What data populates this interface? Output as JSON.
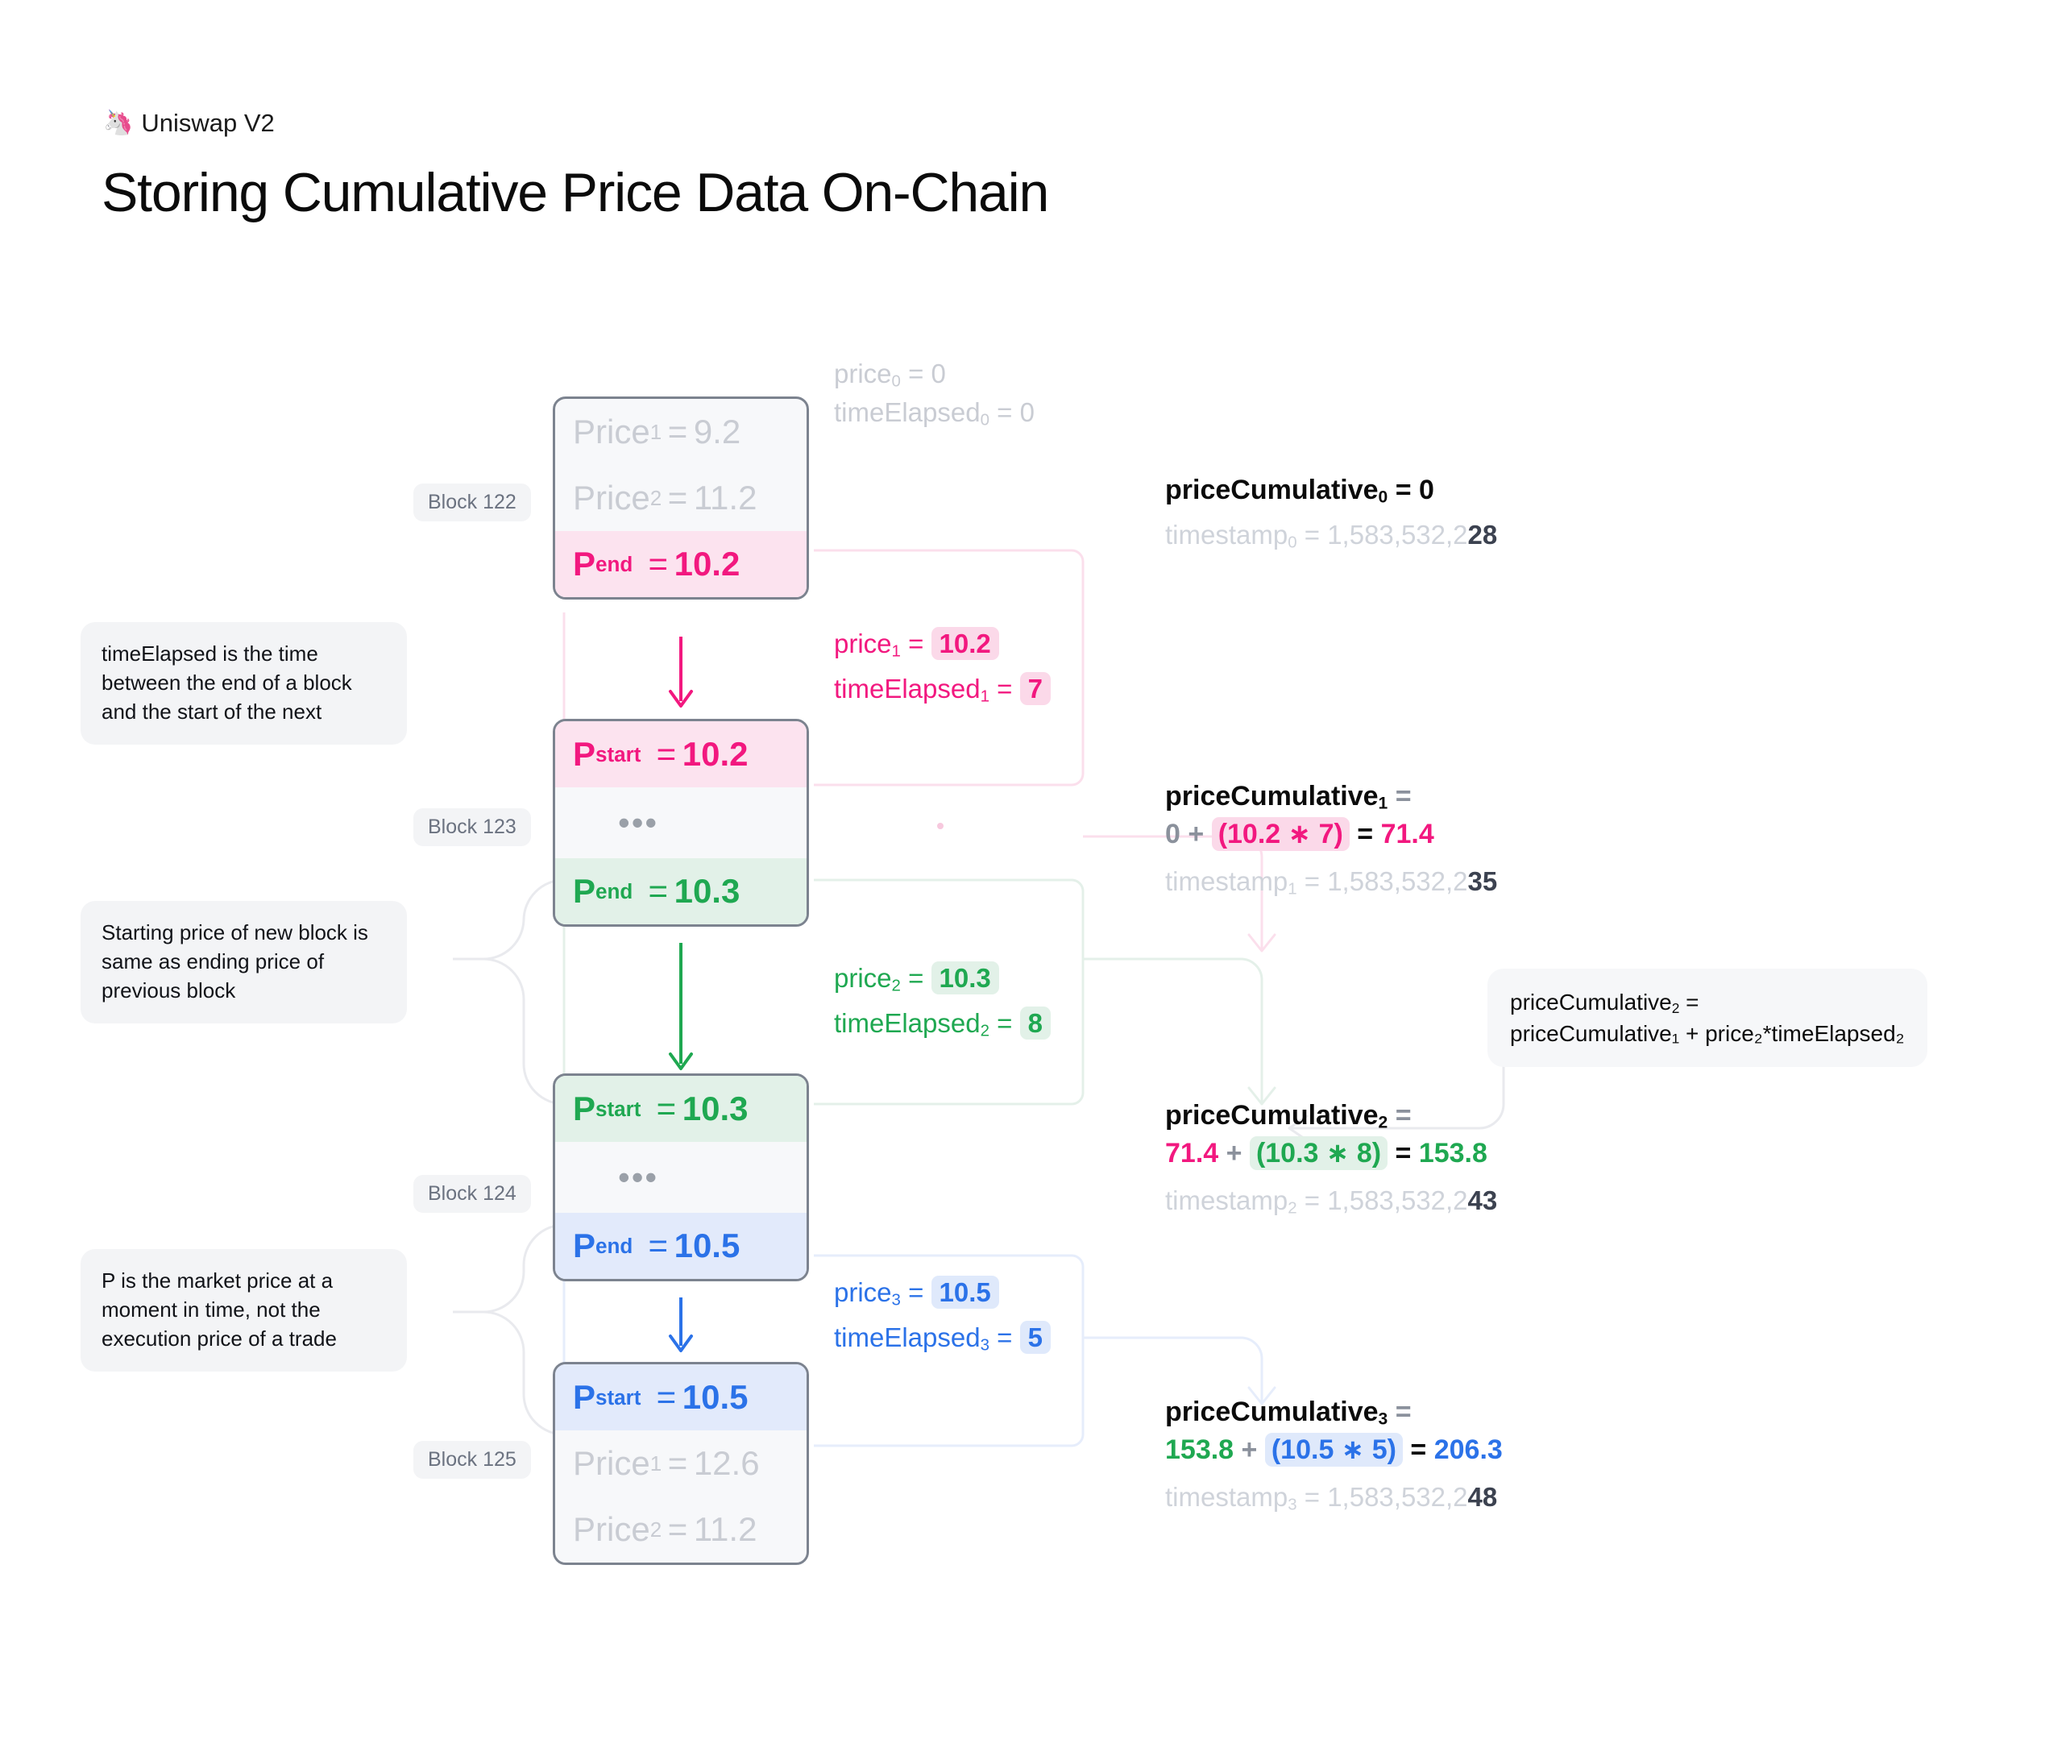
{
  "header": {
    "brand": "Uniswap V2",
    "brand_icon": "unicorn-icon",
    "title": "Storing Cumulative Price Data On-Chain"
  },
  "notes": [
    {
      "id": "note-timeelapsed",
      "text": "timeElapsed is the time between the end of a block and the start of the next"
    },
    {
      "id": "note-starting-price",
      "text": "Starting price of new block is same as ending price of previous block"
    },
    {
      "id": "note-market-price",
      "text": "P is the market price at a moment in time, not the execution price of a trade"
    }
  ],
  "blocks": [
    {
      "label": "Block 122",
      "rows": [
        {
          "kind": "ghost",
          "name": "Price",
          "sub": "1",
          "value": "9.2"
        },
        {
          "kind": "ghost",
          "name": "Price",
          "sub": "2",
          "value": "11.2"
        },
        {
          "kind": "pink",
          "name": "P",
          "sub": "end",
          "value": "10.2"
        }
      ]
    },
    {
      "label": "Block 123",
      "rows": [
        {
          "kind": "pink",
          "name": "P",
          "sub": "start",
          "value": "10.2"
        },
        {
          "kind": "dots",
          "value": "•••"
        },
        {
          "kind": "green",
          "name": "P",
          "sub": "end",
          "value": "10.3"
        }
      ]
    },
    {
      "label": "Block 124",
      "rows": [
        {
          "kind": "green",
          "name": "P",
          "sub": "start",
          "value": "10.3"
        },
        {
          "kind": "dots",
          "value": "•••"
        },
        {
          "kind": "blue",
          "name": "P",
          "sub": "end",
          "value": "10.5"
        }
      ]
    },
    {
      "label": "Block 125",
      "rows": [
        {
          "kind": "blue",
          "name": "P",
          "sub": "start",
          "value": "10.5"
        },
        {
          "kind": "ghost",
          "name": "Price",
          "sub": "1",
          "value": "12.6"
        },
        {
          "kind": "ghost",
          "name": "Price",
          "sub": "2",
          "value": "11.2"
        }
      ]
    }
  ],
  "price_labels": [
    {
      "index": "0",
      "color": "gray",
      "price_name": "price",
      "price_value": "0",
      "time_name": "timeElapsed",
      "time_value": "0"
    },
    {
      "index": "1",
      "color": "pink",
      "price_name": "price",
      "price_value": "10.2",
      "time_name": "timeElapsed",
      "time_value": "7"
    },
    {
      "index": "2",
      "color": "green",
      "price_name": "price",
      "price_value": "10.3",
      "time_name": "timeElapsed",
      "time_value": "8"
    },
    {
      "index": "3",
      "color": "blue",
      "price_name": "price",
      "price_value": "10.5",
      "time_name": "timeElapsed",
      "time_value": "5"
    }
  ],
  "cumulatives": [
    {
      "name": "priceCumulative",
      "index": "0",
      "head_eq": "= 0",
      "expr": null,
      "timestamp_label": "timestamp",
      "timestamp_dim": "1,583,532,2",
      "timestamp_bold": "28"
    },
    {
      "name": "priceCumulative",
      "index": "1",
      "head_eq": "=",
      "expr": {
        "prev": "0",
        "plus": "+",
        "chip": "(10.2 ∗ 7)",
        "eq": "=",
        "result": "71.4",
        "prev_color": "gray",
        "chip_color": "pink",
        "result_color": "pink"
      },
      "timestamp_label": "timestamp",
      "timestamp_dim": "1,583,532,2",
      "timestamp_bold": "35"
    },
    {
      "name": "priceCumulative",
      "index": "2",
      "head_eq": "=",
      "expr": {
        "prev": "71.4",
        "plus": "+",
        "chip": "(10.3 ∗ 8)",
        "eq": "=",
        "result": "153.8",
        "prev_color": "pink",
        "chip_color": "green",
        "result_color": "green"
      },
      "timestamp_label": "timestamp",
      "timestamp_dim": "1,583,532,2",
      "timestamp_bold": "43"
    },
    {
      "name": "priceCumulative",
      "index": "3",
      "head_eq": "=",
      "expr": {
        "prev": "153.8",
        "plus": "+",
        "chip": "(10.5 ∗ 5)",
        "eq": "=",
        "result": "206.3",
        "prev_color": "green",
        "chip_color": "blue",
        "result_color": "blue"
      },
      "timestamp_label": "timestamp",
      "timestamp_dim": "1,583,532,2",
      "timestamp_bold": "48"
    }
  ],
  "callout": {
    "line1_name": "priceCumulative",
    "line1_sub": "2",
    "line1_tail": " =",
    "line2": "priceCumulative₁ + price₂*timeElapsed₂"
  },
  "colors": {
    "pink": "#f2187f",
    "green": "#1fa851",
    "blue": "#2b72e8",
    "gray": "#c9ccd3",
    "muted": "#8b919c",
    "card_border": "#7c838f",
    "note_bg": "#f3f4f6"
  }
}
